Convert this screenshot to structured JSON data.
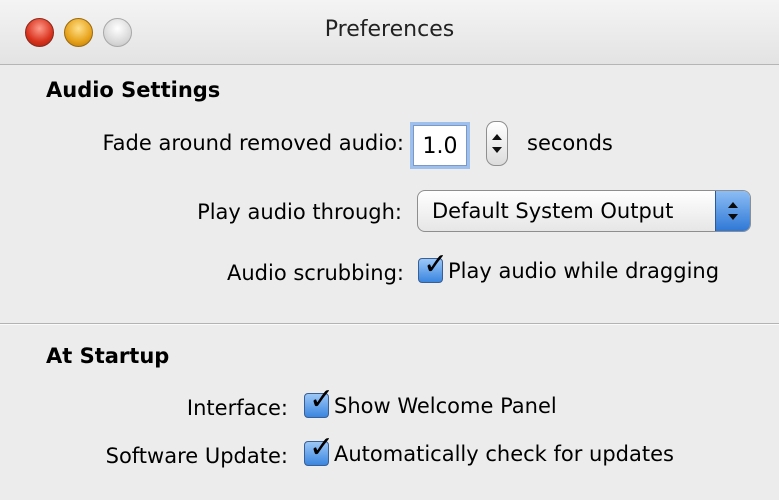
{
  "window": {
    "title": "Preferences",
    "controls": [
      "close-button",
      "minimize-button",
      "zoom-button"
    ]
  },
  "audio_settings": {
    "heading": "Audio Settings",
    "fade": {
      "label": "Fade around removed audio:",
      "value": "1.0",
      "unit": "seconds"
    },
    "play_through": {
      "label": "Play audio through:",
      "selected": "Default System Output"
    },
    "scrubbing": {
      "label": "Audio scrubbing:",
      "checkbox_label": "Play audio while dragging",
      "checked": true
    }
  },
  "at_startup": {
    "heading": "At Startup",
    "interface": {
      "label": "Interface:",
      "checkbox_label": "Show Welcome Panel",
      "checked": true
    },
    "software_update": {
      "label": "Software Update:",
      "checkbox_label": "Automatically check for updates",
      "checked": true
    }
  },
  "colors": {
    "focus_ring": "#9ec0ec",
    "aqua_blue": "#3a86e0",
    "window_bg": "#ececec"
  }
}
